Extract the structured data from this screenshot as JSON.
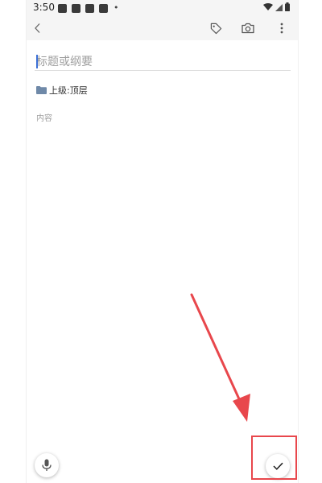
{
  "status_bar": {
    "time": "3:50",
    "notification_icons": [
      "notification-icon",
      "notification-icon",
      "notification-icon",
      "notification-icon"
    ],
    "dot": "•",
    "system_icons": [
      "wifi-icon",
      "signal-icon",
      "battery-icon"
    ]
  },
  "toolbar": {
    "icons": [
      "back-icon",
      "tag-icon",
      "camera-icon",
      "more-vertical-icon"
    ]
  },
  "editor": {
    "title_placeholder": "标题或纲要",
    "title_value": "",
    "parent_label": "上级:顶层",
    "content_placeholder": "内容",
    "content_value": ""
  },
  "fabs": {
    "mic_icon": "mic-icon",
    "save_icon": "check-icon"
  },
  "annotation": {
    "color": "#e8474c"
  }
}
